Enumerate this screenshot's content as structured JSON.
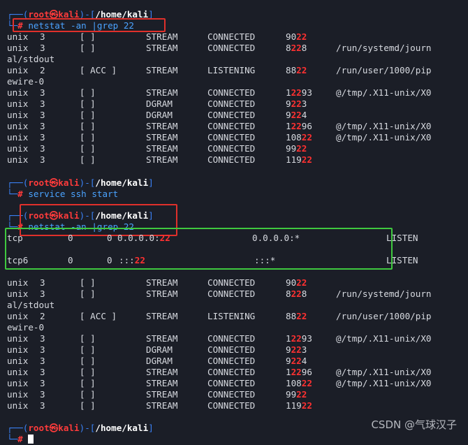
{
  "prompt": {
    "user": "root",
    "host": "kali",
    "path": "/home/kali",
    "symbol": "㉿",
    "hash": "#"
  },
  "commands": [
    "netstat -an |grep 22",
    "service ssh start",
    "netstat -an |grep 22",
    ""
  ],
  "block1": [
    [
      "unix",
      "3",
      "[ ]",
      "STREAM",
      "CONNECTED",
      "90",
      "22",
      "",
      ""
    ],
    [
      "unix",
      "3",
      "[ ]",
      "STREAM",
      "CONNECTED",
      "8",
      "22",
      "8",
      "/run/systemd/journ"
    ],
    [
      "al/stdout",
      "",
      "",
      "",
      "",
      "",
      "",
      "",
      ""
    ],
    [
      "unix",
      "2",
      "[ ACC ]",
      "STREAM",
      "LISTENING",
      "88",
      "22",
      "",
      "/run/user/1000/pip"
    ],
    [
      "ewire-0",
      "",
      "",
      "",
      "",
      "",
      "",
      "",
      ""
    ],
    [
      "unix",
      "3",
      "[ ]",
      "STREAM",
      "CONNECTED",
      "1",
      "22",
      "93",
      "@/tmp/.X11-unix/X0"
    ],
    [
      "unix",
      "3",
      "[ ]",
      "DGRAM",
      "CONNECTED",
      "9",
      "22",
      "3",
      ""
    ],
    [
      "unix",
      "3",
      "[ ]",
      "DGRAM",
      "CONNECTED",
      "9",
      "22",
      "4",
      ""
    ],
    [
      "unix",
      "3",
      "[ ]",
      "STREAM",
      "CONNECTED",
      "1",
      "22",
      "96",
      "@/tmp/.X11-unix/X0"
    ],
    [
      "unix",
      "3",
      "[ ]",
      "STREAM",
      "CONNECTED",
      "108",
      "22",
      "",
      "@/tmp/.X11-unix/X0"
    ],
    [
      "unix",
      "3",
      "[ ]",
      "STREAM",
      "CONNECTED",
      "99",
      "22",
      "",
      ""
    ],
    [
      "unix",
      "3",
      "[ ]",
      "STREAM",
      "CONNECTED",
      "119",
      "22",
      "",
      ""
    ]
  ],
  "tcp_rows": [
    {
      "proto": "tcp",
      "recv": "0",
      "send": "0",
      "local_pre": "0.0.0.0:",
      "local_hl": "22",
      "foreign": "0.0.0.0:*",
      "state": "LISTEN"
    },
    {
      "proto": "tcp6",
      "recv": "0",
      "send": "0",
      "local_pre": ":::",
      "local_hl": "22",
      "foreign": ":::*",
      "state": "LISTEN"
    }
  ],
  "block2": [
    [
      "unix",
      "3",
      "[ ]",
      "STREAM",
      "CONNECTED",
      "90",
      "22",
      "",
      ""
    ],
    [
      "unix",
      "3",
      "[ ]",
      "STREAM",
      "CONNECTED",
      "8",
      "22",
      "8",
      "/run/systemd/journ"
    ],
    [
      "al/stdout",
      "",
      "",
      "",
      "",
      "",
      "",
      "",
      ""
    ],
    [
      "unix",
      "2",
      "[ ACC ]",
      "STREAM",
      "LISTENING",
      "88",
      "22",
      "",
      "/run/user/1000/pip"
    ],
    [
      "ewire-0",
      "",
      "",
      "",
      "",
      "",
      "",
      "",
      ""
    ],
    [
      "unix",
      "3",
      "[ ]",
      "STREAM",
      "CONNECTED",
      "1",
      "22",
      "93",
      "@/tmp/.X11-unix/X0"
    ],
    [
      "unix",
      "3",
      "[ ]",
      "DGRAM",
      "CONNECTED",
      "9",
      "22",
      "3",
      ""
    ],
    [
      "unix",
      "3",
      "[ ]",
      "DGRAM",
      "CONNECTED",
      "9",
      "22",
      "4",
      ""
    ],
    [
      "unix",
      "3",
      "[ ]",
      "STREAM",
      "CONNECTED",
      "1",
      "22",
      "96",
      "@/tmp/.X11-unix/X0"
    ],
    [
      "unix",
      "3",
      "[ ]",
      "STREAM",
      "CONNECTED",
      "108",
      "22",
      "",
      "@/tmp/.X11-unix/X0"
    ],
    [
      "unix",
      "3",
      "[ ]",
      "STREAM",
      "CONNECTED",
      "99",
      "22",
      "",
      ""
    ],
    [
      "unix",
      "3",
      "[ ]",
      "STREAM",
      "CONNECTED",
      "119",
      "22",
      "",
      ""
    ]
  ],
  "watermark": "CSDN @气球汉子",
  "colors": {
    "background": "#1b1e27",
    "prompt_frame": "#3b82f6",
    "root": "#ff3b3b",
    "highlight": "#ff3131",
    "red_box": "#e0302b",
    "green_box": "#3fc93f"
  }
}
